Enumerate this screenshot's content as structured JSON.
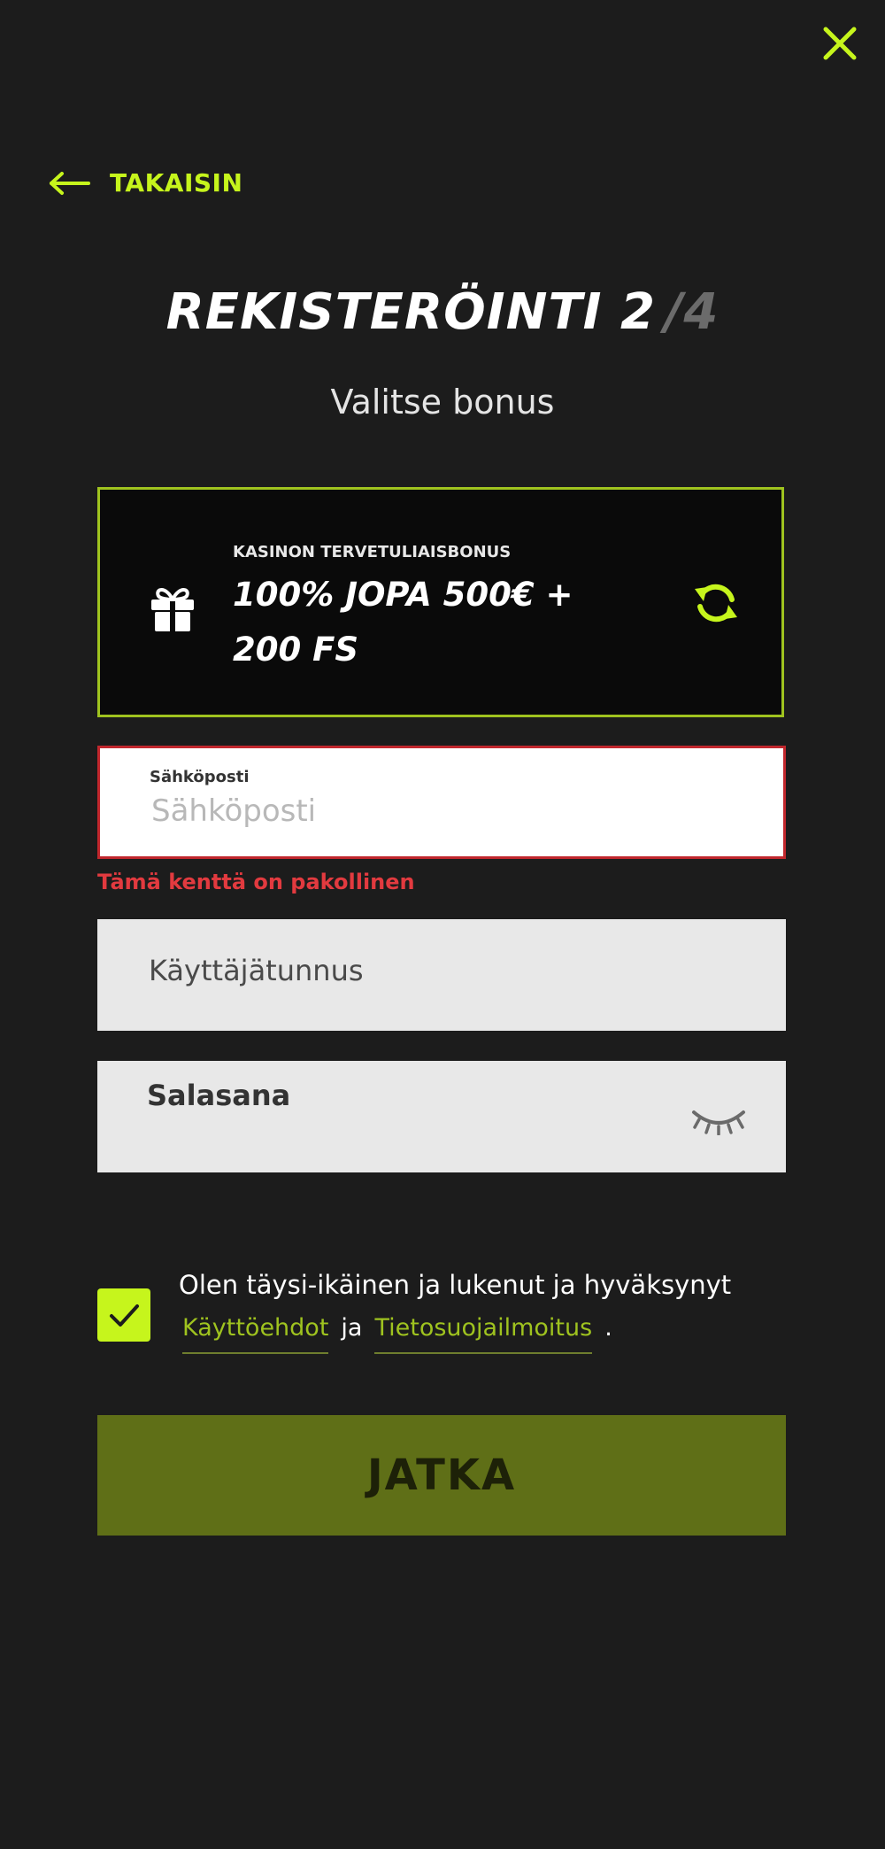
{
  "header": {
    "close_icon": "close-icon",
    "back_label": "TAKAISIN"
  },
  "title": {
    "text": "REKISTERÖINTI 2",
    "total": "/4"
  },
  "subtitle": "Valitse bonus",
  "bonus": {
    "kicker": "KASINON TERVETULIAISBONUS",
    "offer": "100% JOPA 500€ + 200 FS",
    "icon": "gift-icon",
    "action_icon": "refresh-icon"
  },
  "form": {
    "email": {
      "label": "Sähköposti",
      "placeholder": "Sähköposti",
      "value": "",
      "error": "Tämä kenttä on pakollinen"
    },
    "username": {
      "placeholder": "Käyttäjätunnus",
      "value": ""
    },
    "password": {
      "label": "Salasana",
      "value": "",
      "toggle_icon": "eye-closed-icon"
    },
    "consent": {
      "checked": true,
      "text": "Olen täysi-ikäinen ja lukenut ja hyväksynyt",
      "link_terms": "Käyttöehdot",
      "joiner": "ja",
      "link_privacy": "Tietosuojailmoitus",
      "end": "."
    },
    "submit_label": "JATKA"
  },
  "colors": {
    "background": "#1c1c1c",
    "accent": "#c6f51c",
    "accent_dark": "#9fc31f",
    "error": "#e23a3f",
    "button": "#5f6f17"
  }
}
